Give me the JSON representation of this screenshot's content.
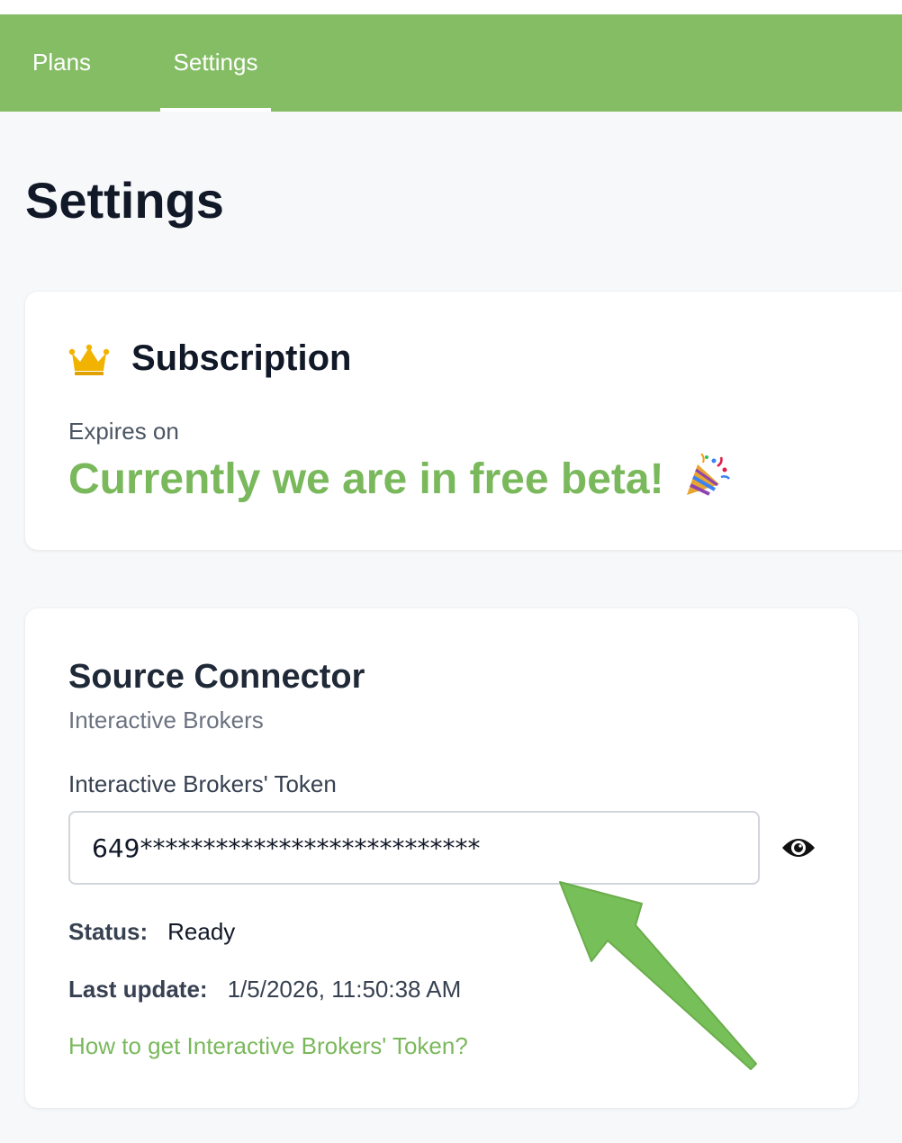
{
  "nav": {
    "tabs": [
      {
        "label": "Plans",
        "active": false
      },
      {
        "label": "Settings",
        "active": true
      }
    ],
    "background_color": "#85bd65"
  },
  "page": {
    "title": "Settings"
  },
  "subscription": {
    "icon": "crown-icon",
    "title": "Subscription",
    "expires_label": "Expires on",
    "status_message": "Currently we are in free beta!",
    "status_icon": "party-popper-icon",
    "accent_color": "#7ab85c"
  },
  "connector": {
    "title": "Source Connector",
    "subtitle": "Interactive Brokers",
    "token_label": "Interactive Brokers' Token",
    "token_value": "649***************************",
    "reveal_icon": "eye-icon",
    "status_label": "Status:",
    "status_value": "Ready",
    "update_label": "Last update:",
    "update_value": "1/5/2026, 11:50:38 AM",
    "help_link": "How to get Interactive Brokers' Token?"
  },
  "annotation": {
    "type": "arrow",
    "color": "#77bf58"
  }
}
